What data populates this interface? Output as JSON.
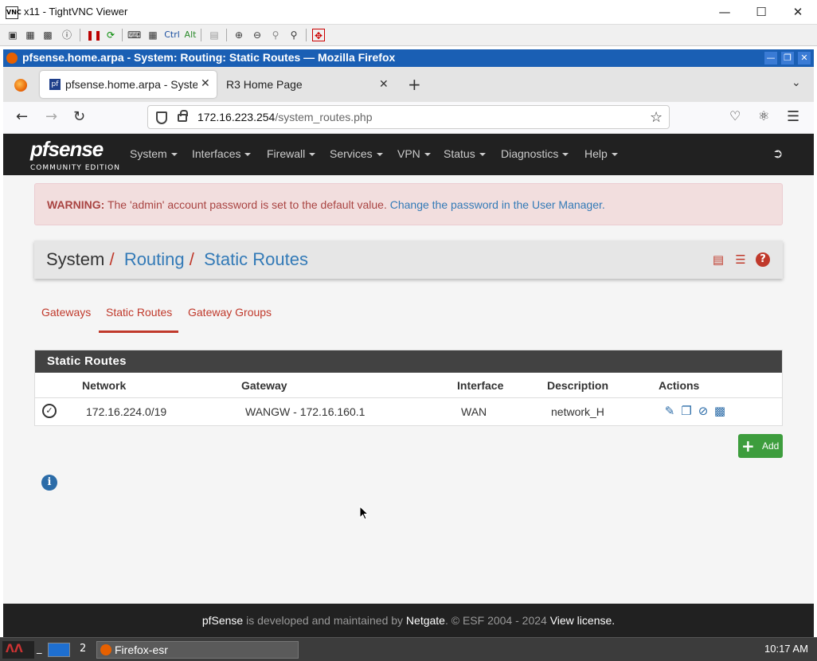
{
  "vnc": {
    "title": "x11 - TightVNC Viewer",
    "logo": "VNC",
    "toolbar_labels": [
      "Ctrl",
      "Alt"
    ]
  },
  "firefox": {
    "window_title": "pfsense.home.arpa - System: Routing: Static Routes — Mozilla Firefox",
    "tabs": [
      {
        "label": "pfsense.home.arpa - System: Routing",
        "active": true
      },
      {
        "label": "R3 Home Page",
        "active": false
      }
    ],
    "url_host": "172.16.223.254",
    "url_path": "/system_routes.php"
  },
  "pfsense": {
    "logo_text": "pfsense",
    "logo_sub": "COMMUNITY EDITION",
    "menu": [
      "System",
      "Interfaces",
      "Firewall",
      "Services",
      "VPN",
      "Status",
      "Diagnostics",
      "Help"
    ],
    "warning_label": "WARNING:",
    "warning_text": "The 'admin' account password is set to the default value.",
    "warning_link": "Change the password in the User Manager.",
    "breadcrumb": {
      "root": "System",
      "mid": "Routing",
      "leaf": "Static Routes"
    },
    "subtabs": [
      "Gateways",
      "Static Routes",
      "Gateway Groups"
    ],
    "panel_title": "Static Routes",
    "columns": [
      "Network",
      "Gateway",
      "Interface",
      "Description",
      "Actions"
    ],
    "rows": [
      {
        "network": "172.16.224.0/19",
        "gateway": "WANGW - 172.16.160.1",
        "interface": "WAN",
        "description": "network_H"
      }
    ],
    "add_label": "Add",
    "footer": {
      "brand": "pfSense",
      "mid": " is developed and maintained by ",
      "company": "Netgate",
      "copyright": ". © ESF 2004 - 2024 ",
      "license": "View license."
    }
  },
  "taskbar": {
    "workspace": "2",
    "task_label": "Firefox-esr",
    "clock": "10:17 AM"
  },
  "colors": {
    "accent": "#c0392b",
    "link": "#337ab7",
    "header": "#212121",
    "add_button": "#3d9d3d"
  }
}
